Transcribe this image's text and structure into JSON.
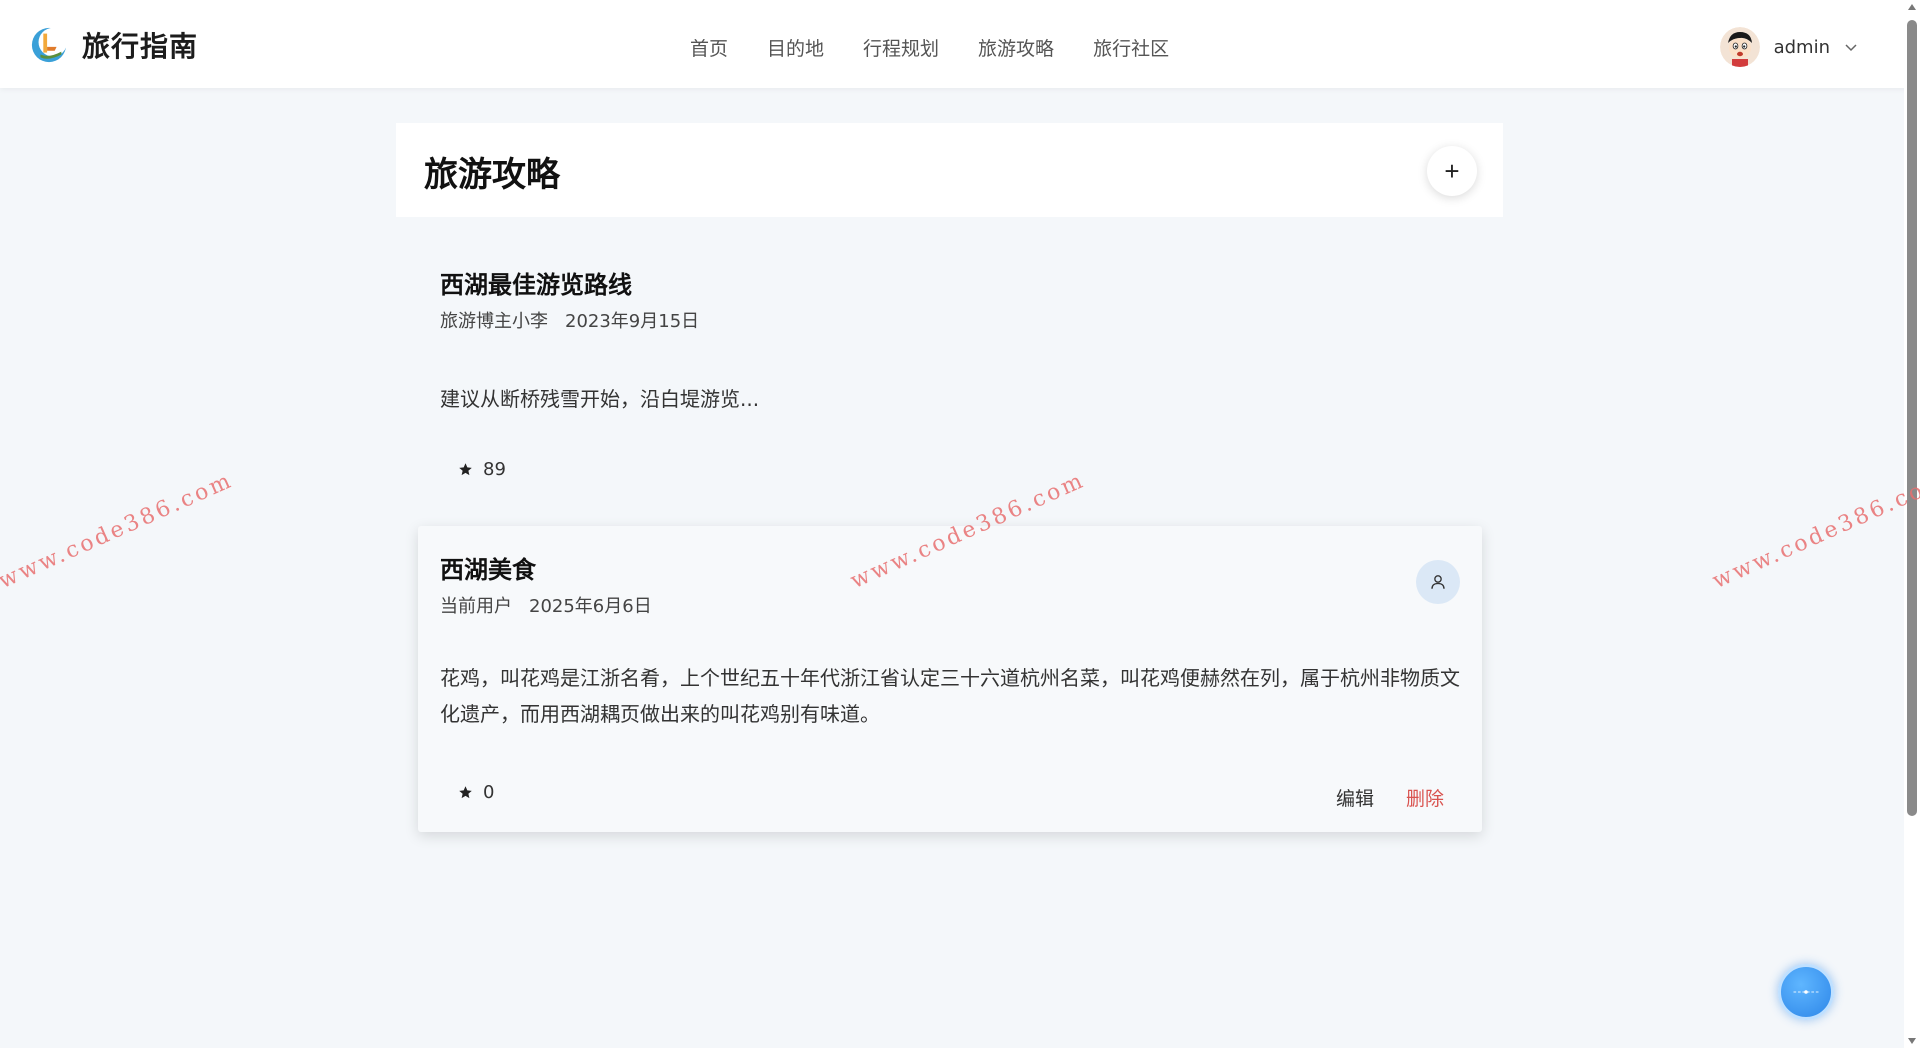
{
  "header": {
    "brand_name": "旅行指南",
    "nav": [
      {
        "label": "首页"
      },
      {
        "label": "目的地"
      },
      {
        "label": "行程规划"
      },
      {
        "label": "旅游攻略"
      },
      {
        "label": "旅行社区"
      }
    ],
    "user": {
      "username": "admin"
    }
  },
  "page": {
    "title": "旅游攻略",
    "add_label": "+"
  },
  "guides": [
    {
      "title": "西湖最佳游览路线",
      "author": "旅游博主小李",
      "date": "2023年9月15日",
      "excerpt": "建议从断桥残雪开始，沿白堤游览...",
      "rating": "89"
    },
    {
      "title": "西湖美食",
      "author": "当前用户",
      "date": "2025年6月6日",
      "excerpt": "花鸡，叫花鸡是江浙名肴，上个世纪五十年代浙江省认定三十六道杭州名菜，叫花鸡便赫然在列，属于杭州非物质文化遗产，而用西湖耦页做出来的叫花鸡别有味道。",
      "rating": "0",
      "actions": {
        "edit": "编辑",
        "delete": "删除"
      }
    }
  ],
  "watermark": "www.code386.com",
  "colors": {
    "accent_blue": "#2d86e8",
    "delete_red": "#d9534f",
    "page_bg": "#f4f7fa"
  }
}
